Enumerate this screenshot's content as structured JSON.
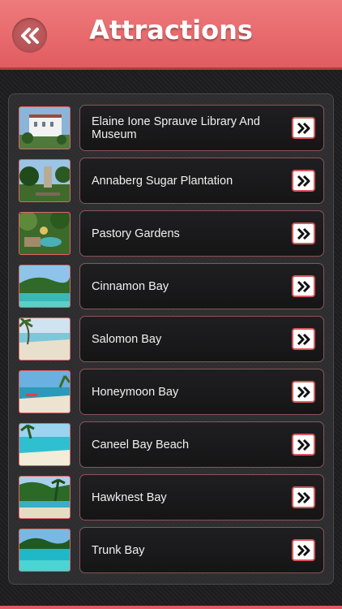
{
  "header": {
    "title": "Attractions",
    "back_icon": "double-chevron-left-icon"
  },
  "colors": {
    "header": "#e8686b",
    "accent": "#d9595c",
    "background": "#1e1e20"
  },
  "items": [
    {
      "label": "Elaine Ione Sprauve Library And Museum",
      "thumb": "building-photo"
    },
    {
      "label": "Annaberg Sugar Plantation",
      "thumb": "ruins-photo"
    },
    {
      "label": "Pastory Gardens",
      "thumb": "garden-photo"
    },
    {
      "label": "Cinnamon Bay",
      "thumb": "beach-photo"
    },
    {
      "label": "Salomon Bay",
      "thumb": "beach-photo"
    },
    {
      "label": "Honeymoon Bay",
      "thumb": "beach-photo"
    },
    {
      "label": "Caneel Bay Beach",
      "thumb": "beach-photo"
    },
    {
      "label": "Hawknest Bay",
      "thumb": "beach-photo"
    },
    {
      "label": "Trunk Bay",
      "thumb": "beach-photo"
    }
  ]
}
